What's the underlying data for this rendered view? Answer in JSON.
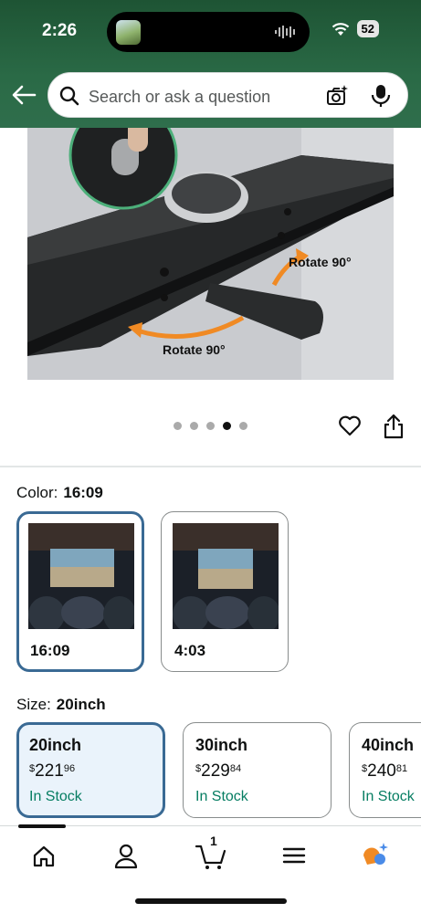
{
  "status_bar": {
    "time": "2:26",
    "battery": "52"
  },
  "search": {
    "placeholder": "Search or ask a question"
  },
  "gallery": {
    "annotation_top": "Rotate 90°",
    "annotation_bottom": "Rotate 90°",
    "dots_total": 5,
    "active_dot": 4
  },
  "color": {
    "label": "Color:",
    "selected": "16:09",
    "options": [
      {
        "label": "16:09",
        "selected": true
      },
      {
        "label": "4:03",
        "selected": false
      }
    ]
  },
  "size": {
    "label": "Size:",
    "selected": "20inch",
    "options": [
      {
        "name": "20inch",
        "price_symbol": "$",
        "price_whole": "221",
        "price_cents": "96",
        "stock": "In Stock",
        "selected": true
      },
      {
        "name": "30inch",
        "price_symbol": "$",
        "price_whole": "229",
        "price_cents": "84",
        "stock": "In Stock",
        "selected": false
      },
      {
        "name": "40inch",
        "price_symbol": "$",
        "price_whole": "240",
        "price_cents": "81",
        "stock": "In Stock",
        "selected": false
      }
    ]
  },
  "tabbar": {
    "cart_count": "1",
    "items": [
      "home-icon",
      "account-icon",
      "cart-icon",
      "menu-icon",
      "rufus-ai-icon"
    ]
  },
  "colors": {
    "header_green": "#2a6a46",
    "selected_border": "#3a6a94",
    "stock_green": "#067d62",
    "annotation_orange": "#f08a24"
  }
}
